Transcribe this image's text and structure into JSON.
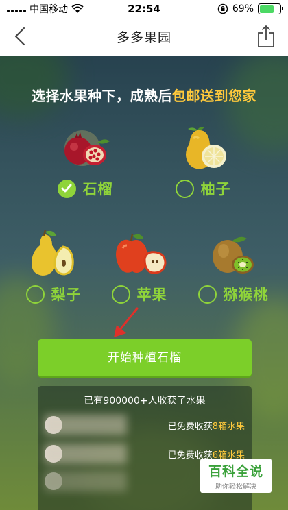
{
  "status_bar": {
    "carrier": "中国移动",
    "time": "22:54",
    "battery_percent": "69%",
    "battery_level": 0.69,
    "icons": [
      "signal-dots",
      "wifi-icon",
      "orientation-lock-icon",
      "battery-icon"
    ]
  },
  "nav": {
    "title": "多多果园",
    "back_icon": "chevron-left-icon",
    "share_icon": "share-icon"
  },
  "stage": {
    "headline_main": "选择水果种下，成熟后",
    "headline_highlight": "包邮送到您家",
    "fruits": [
      {
        "label": "石榴",
        "icon": "pomegranate-icon",
        "selected": true
      },
      {
        "label": "柚子",
        "icon": "pomelo-icon",
        "selected": false
      },
      {
        "label": "梨子",
        "icon": "pear-icon",
        "selected": false
      },
      {
        "label": "苹果",
        "icon": "apple-icon",
        "selected": false
      },
      {
        "label": "猕猴桃",
        "icon": "kiwi-icon",
        "selected": false
      }
    ],
    "plant_button": "开始种植石榴",
    "harvest": {
      "title": "已有900000+人收获了水果",
      "rows": [
        {
          "prefix": "已免费收获",
          "count": "8箱水果"
        },
        {
          "prefix": "已免费收获",
          "count": "6箱水果"
        }
      ]
    }
  },
  "watermark": {
    "main": "百科全说",
    "sub": "助你轻松解决"
  },
  "colors": {
    "accent_green": "#8fd43a",
    "button_green": "#7ccf29",
    "highlight_yellow": "#ffc93c"
  }
}
